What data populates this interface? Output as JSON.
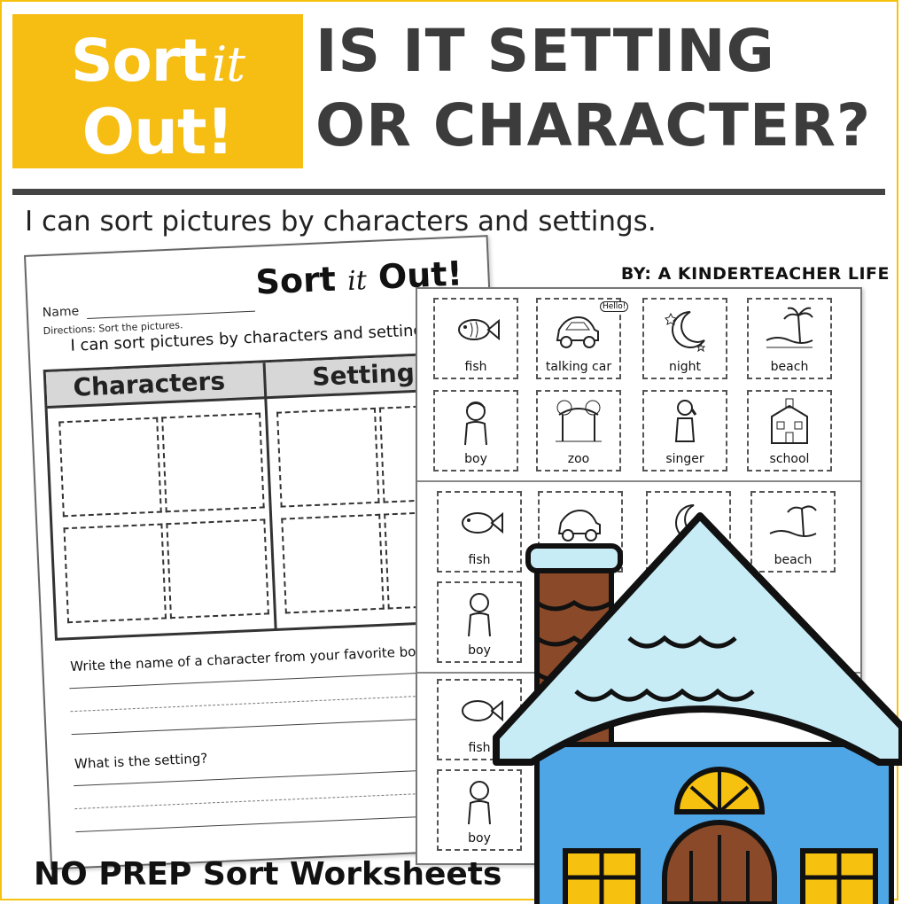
{
  "logo": {
    "line1_word": "Sort",
    "line1_script": "it",
    "line2": "Out!"
  },
  "title": {
    "line1": "IS IT SETTING",
    "line2": "OR CHARACTER?"
  },
  "subtitle": "I can sort pictures by characters and settings.",
  "byline": "BY: A KINDERTEACHER LIFE",
  "worksheet": {
    "title_word": "Sort",
    "title_script": "it",
    "title_end": "Out!",
    "name_label": "Name",
    "directions": "Directions: Sort the pictures.",
    "goal": "I can sort pictures by characters and settings.",
    "col_characters": "Characters",
    "col_settings": "Settings",
    "question1": "Write the name of a character from your favorite book.",
    "question2": "What is the setting?"
  },
  "cards": {
    "row1": [
      "fish",
      "talking car",
      "night",
      "beach"
    ],
    "row2": [
      "boy",
      "zoo",
      "singer",
      "school"
    ],
    "row3": [
      "fish",
      "",
      "night",
      "beach"
    ],
    "row4": [
      "boy"
    ],
    "row5": [
      "fish"
    ],
    "row6": [
      "boy"
    ],
    "hello": "Hello!"
  },
  "footer": "NO PREP Sort Worksheets",
  "colors": {
    "accent": "#f6bd13",
    "house_blue": "#4fa6e6",
    "roof_ice": "#c8ecf6",
    "chimney": "#8a4a2a"
  }
}
